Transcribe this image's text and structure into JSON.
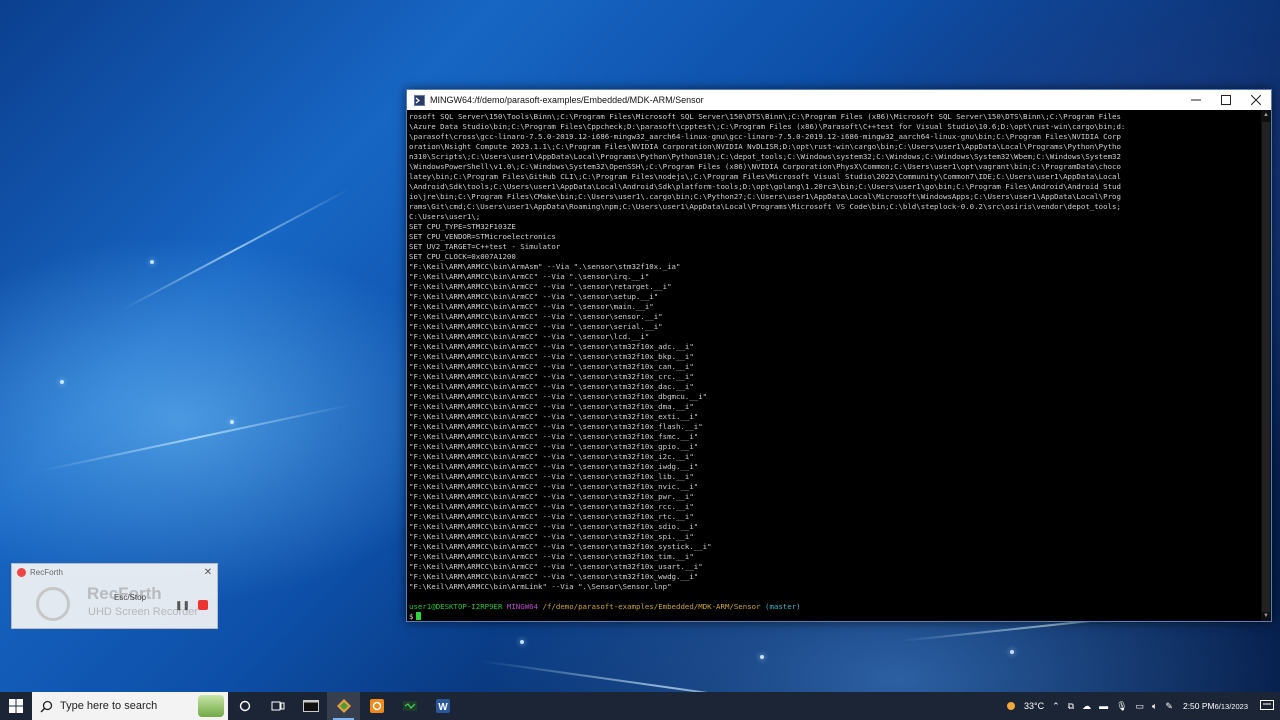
{
  "terminal": {
    "title": "MINGW64:/f/demo/parasoft-examples/Embedded/MDK-ARM/Sensor",
    "lines": [
      "rosoft SQL Server\\150\\Tools\\Binn\\;C:\\Program Files\\Microsoft SQL Server\\150\\DTS\\Binn\\;C:\\Program Files (x86)\\Microsoft SQL Server\\150\\DTS\\Binn\\;C:\\Program Files",
      "\\Azure Data Studio\\bin;C:\\Program Files\\Cppcheck;D:\\parasoft\\cpptest\\;C:\\Program Files (x86)\\Parasoft\\C++test for Visual Studio\\10.6;D:\\opt\\rust-win\\cargo\\bin;d:",
      "\\parasoft\\cross\\gcc-linaro-7.5.0-2019.12-i686-mingw32_aarch64-linux-gnu\\gcc-linaro-7.5.0-2019.12-i686-mingw32_aarch64-linux-gnu\\bin;C:\\Program Files\\NVIDIA Corp",
      "oration\\Nsight Compute 2023.1.1\\;C:\\Program Files\\NVIDIA Corporation\\NVIDIA NvDLISR;D:\\opt\\rust-win\\cargo\\bin;C:\\Users\\user1\\AppData\\Local\\Programs\\Python\\Pytho",
      "n310\\Scripts\\;C:\\Users\\user1\\AppData\\Local\\Programs\\Python\\Python310\\;C:\\depot_tools;C:\\Windows\\system32;C:\\Windows;C:\\Windows\\System32\\Wbem;C:\\Windows\\System32",
      "\\WindowsPowerShell\\v1.0\\;C:\\Windows\\System32\\OpenSSH\\;C:\\Program Files (x86)\\NVIDIA Corporation\\PhysX\\Common;C:\\Users\\user1\\opt\\vagrant\\bin;C:\\ProgramData\\choco",
      "latey\\bin;C:\\Program Files\\GitHub CLI\\;C:\\Program Files\\nodejs\\;C:\\Program Files\\Microsoft Visual Studio\\2022\\Community\\Common7\\IDE;C:\\Users\\user1\\AppData\\Local",
      "\\Android\\Sdk\\tools;C:\\Users\\user1\\AppData\\Local\\Android\\Sdk\\platform-tools;D:\\opt\\golang\\1.20rc3\\bin;C:\\Users\\user1\\go\\bin;C:\\Program Files\\Android\\Android Stud",
      "io\\jre\\bin;C:\\Program Files\\CMake\\bin;C:\\Users\\user1\\.cargo\\bin;C:\\Python27;C:\\Users\\user1\\AppData\\Local\\Microsoft\\WindowsApps;C:\\Users\\user1\\AppData\\Local\\Prog",
      "rams\\Git\\cmd;C:\\Users\\user1\\AppData\\Roaming\\npm;C:\\Users\\user1\\AppData\\Local\\Programs\\Microsoft VS Code\\bin;C:\\bld\\steplock-0.0.2\\src\\osiris\\vendor\\depot_tools;",
      "C:\\Users\\user1\\;",
      "SET CPU_TYPE=STM32F103ZE",
      "SET CPU_VENDOR=STMicroelectronics",
      "SET UV2_TARGET=C++test - Simulator",
      "SET CPU_CLOCK=0x007A1200",
      "\"F:\\Keil\\ARM\\ARMCC\\bin\\ArmAsm\" --Via \".\\sensor\\stm32f10x._ia\"",
      "\"F:\\Keil\\ARM\\ARMCC\\bin\\ArmCC\" --Via \".\\sensor\\irq.__i\"",
      "\"F:\\Keil\\ARM\\ARMCC\\bin\\ArmCC\" --Via \".\\sensor\\retarget.__i\"",
      "\"F:\\Keil\\ARM\\ARMCC\\bin\\ArmCC\" --Via \".\\sensor\\setup.__i\"",
      "\"F:\\Keil\\ARM\\ARMCC\\bin\\ArmCC\" --Via \".\\sensor\\main.__i\"",
      "\"F:\\Keil\\ARM\\ARMCC\\bin\\ArmCC\" --Via \".\\sensor\\sensor.__i\"",
      "\"F:\\Keil\\ARM\\ARMCC\\bin\\ArmCC\" --Via \".\\sensor\\serial.__i\"",
      "\"F:\\Keil\\ARM\\ARMCC\\bin\\ArmCC\" --Via \".\\sensor\\lcd.__i\"",
      "\"F:\\Keil\\ARM\\ARMCC\\bin\\ArmCC\" --Via \".\\sensor\\stm32f10x_adc.__i\"",
      "\"F:\\Keil\\ARM\\ARMCC\\bin\\ArmCC\" --Via \".\\sensor\\stm32f10x_bkp.__i\"",
      "\"F:\\Keil\\ARM\\ARMCC\\bin\\ArmCC\" --Via \".\\sensor\\stm32f10x_can.__i\"",
      "\"F:\\Keil\\ARM\\ARMCC\\bin\\ArmCC\" --Via \".\\sensor\\stm32f10x_crc.__i\"",
      "\"F:\\Keil\\ARM\\ARMCC\\bin\\ArmCC\" --Via \".\\sensor\\stm32f10x_dac.__i\"",
      "\"F:\\Keil\\ARM\\ARMCC\\bin\\ArmCC\" --Via \".\\sensor\\stm32f10x_dbgmcu.__i\"",
      "\"F:\\Keil\\ARM\\ARMCC\\bin\\ArmCC\" --Via \".\\sensor\\stm32f10x_dma.__i\"",
      "\"F:\\Keil\\ARM\\ARMCC\\bin\\ArmCC\" --Via \".\\sensor\\stm32f10x_exti.__i\"",
      "\"F:\\Keil\\ARM\\ARMCC\\bin\\ArmCC\" --Via \".\\sensor\\stm32f10x_flash.__i\"",
      "\"F:\\Keil\\ARM\\ARMCC\\bin\\ArmCC\" --Via \".\\sensor\\stm32f10x_fsmc.__i\"",
      "\"F:\\Keil\\ARM\\ARMCC\\bin\\ArmCC\" --Via \".\\sensor\\stm32f10x_gpio.__i\"",
      "\"F:\\Keil\\ARM\\ARMCC\\bin\\ArmCC\" --Via \".\\sensor\\stm32f10x_i2c.__i\"",
      "\"F:\\Keil\\ARM\\ARMCC\\bin\\ArmCC\" --Via \".\\sensor\\stm32f10x_iwdg.__i\"",
      "\"F:\\Keil\\ARM\\ARMCC\\bin\\ArmCC\" --Via \".\\sensor\\stm32f10x_lib.__i\"",
      "\"F:\\Keil\\ARM\\ARMCC\\bin\\ArmCC\" --Via \".\\sensor\\stm32f10x_nvic.__i\"",
      "\"F:\\Keil\\ARM\\ARMCC\\bin\\ArmCC\" --Via \".\\sensor\\stm32f10x_pwr.__i\"",
      "\"F:\\Keil\\ARM\\ARMCC\\bin\\ArmCC\" --Via \".\\sensor\\stm32f10x_rcc.__i\"",
      "\"F:\\Keil\\ARM\\ARMCC\\bin\\ArmCC\" --Via \".\\sensor\\stm32f10x_rtc.__i\"",
      "\"F:\\Keil\\ARM\\ARMCC\\bin\\ArmCC\" --Via \".\\sensor\\stm32f10x_sdio.__i\"",
      "\"F:\\Keil\\ARM\\ARMCC\\bin\\ArmCC\" --Via \".\\sensor\\stm32f10x_spi.__i\"",
      "\"F:\\Keil\\ARM\\ARMCC\\bin\\ArmCC\" --Via \".\\sensor\\stm32f10x_systick.__i\"",
      "\"F:\\Keil\\ARM\\ARMCC\\bin\\ArmCC\" --Via \".\\sensor\\stm32f10x_tim.__i\"",
      "\"F:\\Keil\\ARM\\ARMCC\\bin\\ArmCC\" --Via \".\\sensor\\stm32f10x_usart.__i\"",
      "\"F:\\Keil\\ARM\\ARMCC\\bin\\ArmCC\" --Via \".\\sensor\\stm32f10x_wwdg.__i\"",
      "\"F:\\Keil\\ARM\\ARMCC\\bin\\ArmLink\" --Via \".\\Sensor\\Sensor.lnp\""
    ],
    "prompt": {
      "user": "user1@DESKTOP-I2RP9ER",
      "system": "MINGW64",
      "path": "/f/demo/parasoft-examples/Embedded/MDK-ARM/Sensor",
      "branch": "(master)",
      "symbol": "$"
    },
    "colors": {
      "background": "#000000",
      "text": "#cfcfcf",
      "user": "#25c33a",
      "system": "#b94ac9",
      "path": "#c8a43a",
      "branch": "#3ab8c8"
    }
  },
  "recorder": {
    "title": "RecForth",
    "big_text": "RecForth",
    "sub_text": "UHD Screen Recorder",
    "overlay_text": "Esc/Stop"
  },
  "taskbar": {
    "search_placeholder": "Type here to search",
    "weather": "33°C",
    "time": "2:50 PM",
    "date": "6/13/2023",
    "apps": [
      "cortana-icon",
      "task-view-icon",
      "terminal-icon",
      "git-icon",
      "app-orange-icon",
      "qt-icon",
      "word-icon"
    ]
  }
}
